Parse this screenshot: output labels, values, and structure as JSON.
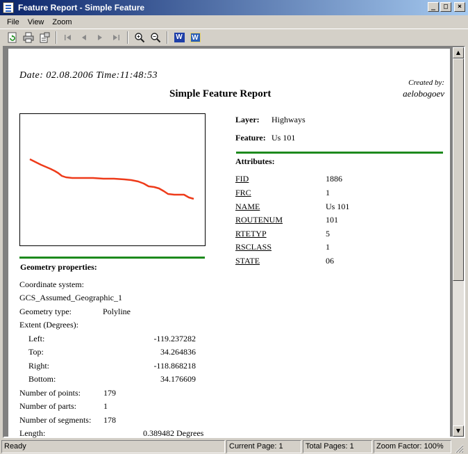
{
  "window": {
    "title": "Feature Report - Simple Feature",
    "min": "_",
    "max": "□",
    "close": "×"
  },
  "menu": [
    "File",
    "View",
    "Zoom"
  ],
  "toolbar": {
    "refresh_icon": "refresh-icon",
    "print_icon": "printer-icon",
    "page_setup_icon": "page-setup-icon",
    "first_icon": "first-page-icon",
    "prev_icon": "previous-page-icon",
    "next_icon": "next-page-icon",
    "last_icon": "last-page-icon",
    "zoom_in_icon": "zoom-in-icon",
    "zoom_out_icon": "zoom-out-icon",
    "word_icon": "word-export-icon",
    "word2_icon": "word-export-alt-icon",
    "word_letter": "W",
    "word2_letter": "W"
  },
  "report": {
    "date": "Date: 02.08.2006 Time:11:48:53",
    "created_by_label": "Created by:",
    "created_by": "aelobogoev",
    "title": "Simple Feature Report",
    "layer_label": "Layer:",
    "layer_value": "Highways",
    "feature_label": "Feature:",
    "feature_value": "Us 101",
    "attributes_heading": "Attributes:",
    "attributes": [
      {
        "name": "FID",
        "value": "1886"
      },
      {
        "name": "FRC",
        "value": "1"
      },
      {
        "name": "NAME",
        "value": "Us 101"
      },
      {
        "name": "ROUTENUM",
        "value": "101"
      },
      {
        "name": "RTETYP",
        "value": "5"
      },
      {
        "name": "RSCLASS",
        "value": "1"
      },
      {
        "name": "STATE",
        "value": "06"
      }
    ],
    "geometry_heading": "Geometry properties:",
    "coord_system_label": "Coordinate system:",
    "coord_system_value": "GCS_Assumed_Geographic_1",
    "geom_type_label": "Geometry type:",
    "geom_type_value": "Polyline",
    "extent_label": "Extent (Degrees):",
    "extent": [
      {
        "label": "Left:",
        "value": "-119.237282"
      },
      {
        "label": "Top:",
        "value": "34.264836"
      },
      {
        "label": "Right:",
        "value": "-118.868218"
      },
      {
        "label": "Bottom:",
        "value": "34.176609"
      }
    ],
    "points_label": "Number of points:",
    "points_value": "179",
    "parts_label": "Number of parts:",
    "parts_value": "1",
    "segments_label": "Number of segments:",
    "segments_value": "178",
    "length_label": "Length:",
    "length_value": "0.389482 Degrees",
    "line_color": "#ee3b1a",
    "divider_color": "#1d8a1d"
  },
  "status": {
    "ready": "Ready",
    "current_page": "Current Page: 1",
    "total_pages": "Total Pages: 1",
    "zoom_factor": "Zoom Factor: 100%"
  }
}
